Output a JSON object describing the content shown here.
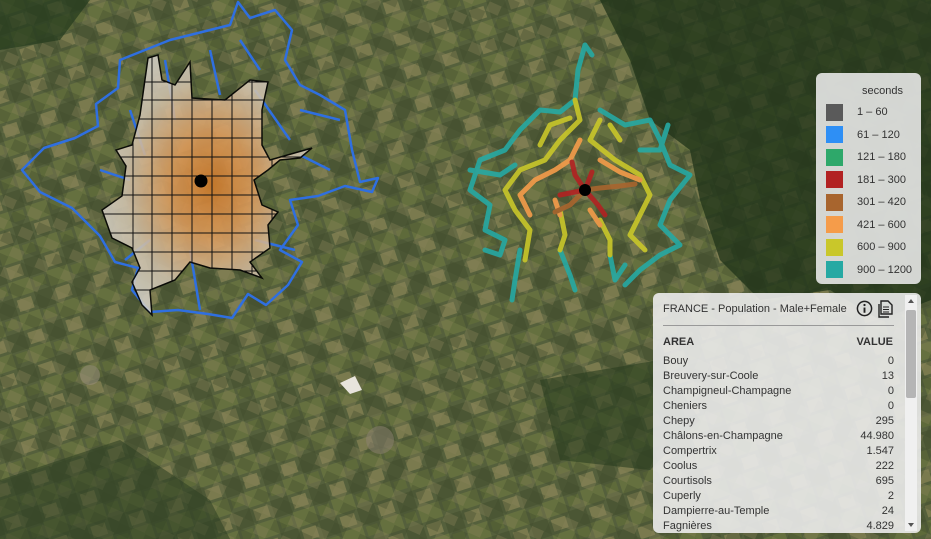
{
  "map": {
    "basemap": "satellite-imagery",
    "isochrone_color": "#d7a26a",
    "grid_color": "#111111",
    "boundary_color": "#2f6fe0",
    "origin_marker_color": "#000000"
  },
  "legend": {
    "title": "seconds",
    "items": [
      {
        "label": "1 – 60",
        "color": "#5a5a5a"
      },
      {
        "label": "61 – 120",
        "color": "#2e8ff5"
      },
      {
        "label": "121 – 180",
        "color": "#2ea86a"
      },
      {
        "label": "181 – 300",
        "color": "#b22222"
      },
      {
        "label": "301 – 420",
        "color": "#a8652e"
      },
      {
        "label": "421 – 600",
        "color": "#f59c4a"
      },
      {
        "label": "600 – 900",
        "color": "#c9c72a"
      },
      {
        "label": "900 – 1200",
        "color": "#26a9a3"
      }
    ]
  },
  "stats": {
    "title": "FRANCE - Population - Male+Female",
    "area_header": "AREA",
    "value_header": "VALUE",
    "info_icon": "info-icon",
    "copy_icon": "copy-icon",
    "rows": [
      {
        "area": "Bouy",
        "value": "0"
      },
      {
        "area": "Breuvery-sur-Coole",
        "value": "13"
      },
      {
        "area": "Champigneul-Champagne",
        "value": "0"
      },
      {
        "area": "Cheniers",
        "value": "0"
      },
      {
        "area": "Chepy",
        "value": "295"
      },
      {
        "area": "Châlons-en-Champagne",
        "value": "44.980"
      },
      {
        "area": "Compertrix",
        "value": "1.547"
      },
      {
        "area": "Coolus",
        "value": "222"
      },
      {
        "area": "Courtisols",
        "value": "695"
      },
      {
        "area": "Cuperly",
        "value": "2"
      },
      {
        "area": "Dampierre-au-Temple",
        "value": "24"
      },
      {
        "area": "Fagnières",
        "value": "4.829"
      }
    ]
  }
}
